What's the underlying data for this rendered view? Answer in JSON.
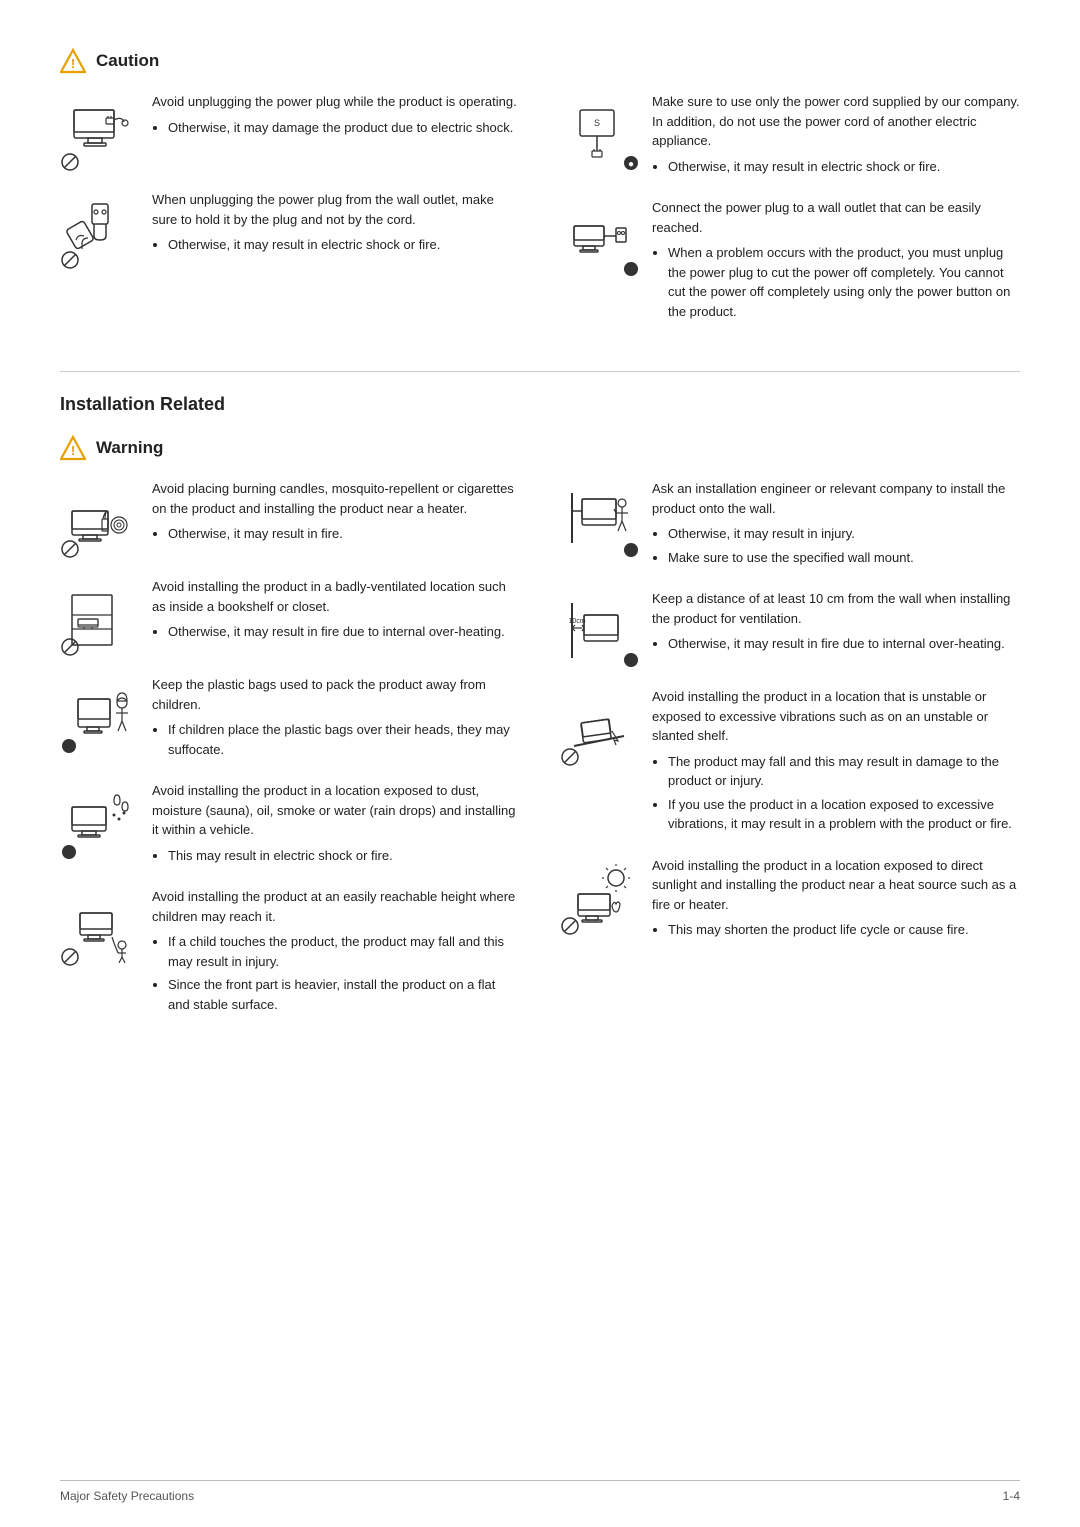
{
  "caution": {
    "title": "Caution",
    "items_left": [
      {
        "id": "caution-left-1",
        "main_text": "Avoid unplugging the power plug while the product is operating.",
        "bullets": [
          "Otherwise, it may damage the product due to electric shock."
        ]
      },
      {
        "id": "caution-left-2",
        "main_text": "When unplugging the power plug from the wall outlet, make sure to hold it by the plug and not by the cord.",
        "bullets": [
          "Otherwise, it may result in electric shock or fire."
        ]
      }
    ],
    "items_right": [
      {
        "id": "caution-right-1",
        "main_text": "Make sure to use only the power cord supplied by our company. In addition, do not use the power cord of another electric appliance.",
        "bullets": [
          "Otherwise, it may result in electric shock or fire."
        ]
      },
      {
        "id": "caution-right-2",
        "main_text": "Connect the power plug to a wall outlet that can be easily reached.",
        "bullets": [
          "When a problem occurs with the product, you must unplug the power plug to cut the power off completely. You cannot cut the power off completely using only the power button on the product."
        ]
      }
    ]
  },
  "installation": {
    "section_title": "Installation Related",
    "warning_title": "Warning",
    "items_left": [
      {
        "id": "warn-left-1",
        "main_text": "Avoid placing burning candles,  mosquito-repellent or cigarettes on the product and installing the product near a heater.",
        "bullets": [
          "Otherwise, it may result in fire."
        ]
      },
      {
        "id": "warn-left-2",
        "main_text": "Avoid installing the product in a badly-ventilated location such as inside a bookshelf or closet.",
        "bullets": [
          "Otherwise, it may result in fire due to internal over-heating."
        ]
      },
      {
        "id": "warn-left-3",
        "main_text": "Keep the plastic bags used to pack the product away from children.",
        "bullets": [
          "If children place the plastic bags over their heads, they may suffocate."
        ]
      },
      {
        "id": "warn-left-4",
        "main_text": "Avoid installing the product in a location exposed to dust, moisture (sauna), oil, smoke or water (rain drops) and installing it within a vehicle.",
        "bullets": [
          "This may result in electric shock or fire."
        ]
      },
      {
        "id": "warn-left-5",
        "main_text": "Avoid installing the product at an easily reachable height where children may reach it.",
        "bullets": [
          "If a child touches the product, the product may fall and this may result in injury.",
          "Since the front part is heavier, install the product on a flat and stable surface."
        ]
      }
    ],
    "items_right": [
      {
        "id": "warn-right-1",
        "main_text": "Ask an installation engineer or relevant company to install the product onto the wall.",
        "bullets": [
          "Otherwise, it may result in injury.",
          "Make sure to use the specified wall mount."
        ]
      },
      {
        "id": "warn-right-2",
        "main_text": "Keep a distance of at least 10 cm from the wall when installing the product for ventilation.",
        "bullets": [
          "Otherwise, it may result in fire due to internal over-heating."
        ]
      },
      {
        "id": "warn-right-3",
        "main_text": "Avoid installing the product in a location that is unstable or exposed to excessive vibrations such as on an unstable or slanted shelf.",
        "bullets": [
          "The product may fall and this may result in damage to the product or injury.",
          "If you use the product in a location exposed to excessive vibrations, it may result in a problem with the product or fire."
        ]
      },
      {
        "id": "warn-right-4",
        "main_text": "Avoid installing the product in a location exposed to direct sunlight and installing the product near a heat source such as a fire or heater.",
        "bullets": [
          "This may shorten the product life cycle or cause fire."
        ]
      }
    ]
  },
  "footer": {
    "left": "Major Safety Precautions",
    "right": "1-4"
  }
}
